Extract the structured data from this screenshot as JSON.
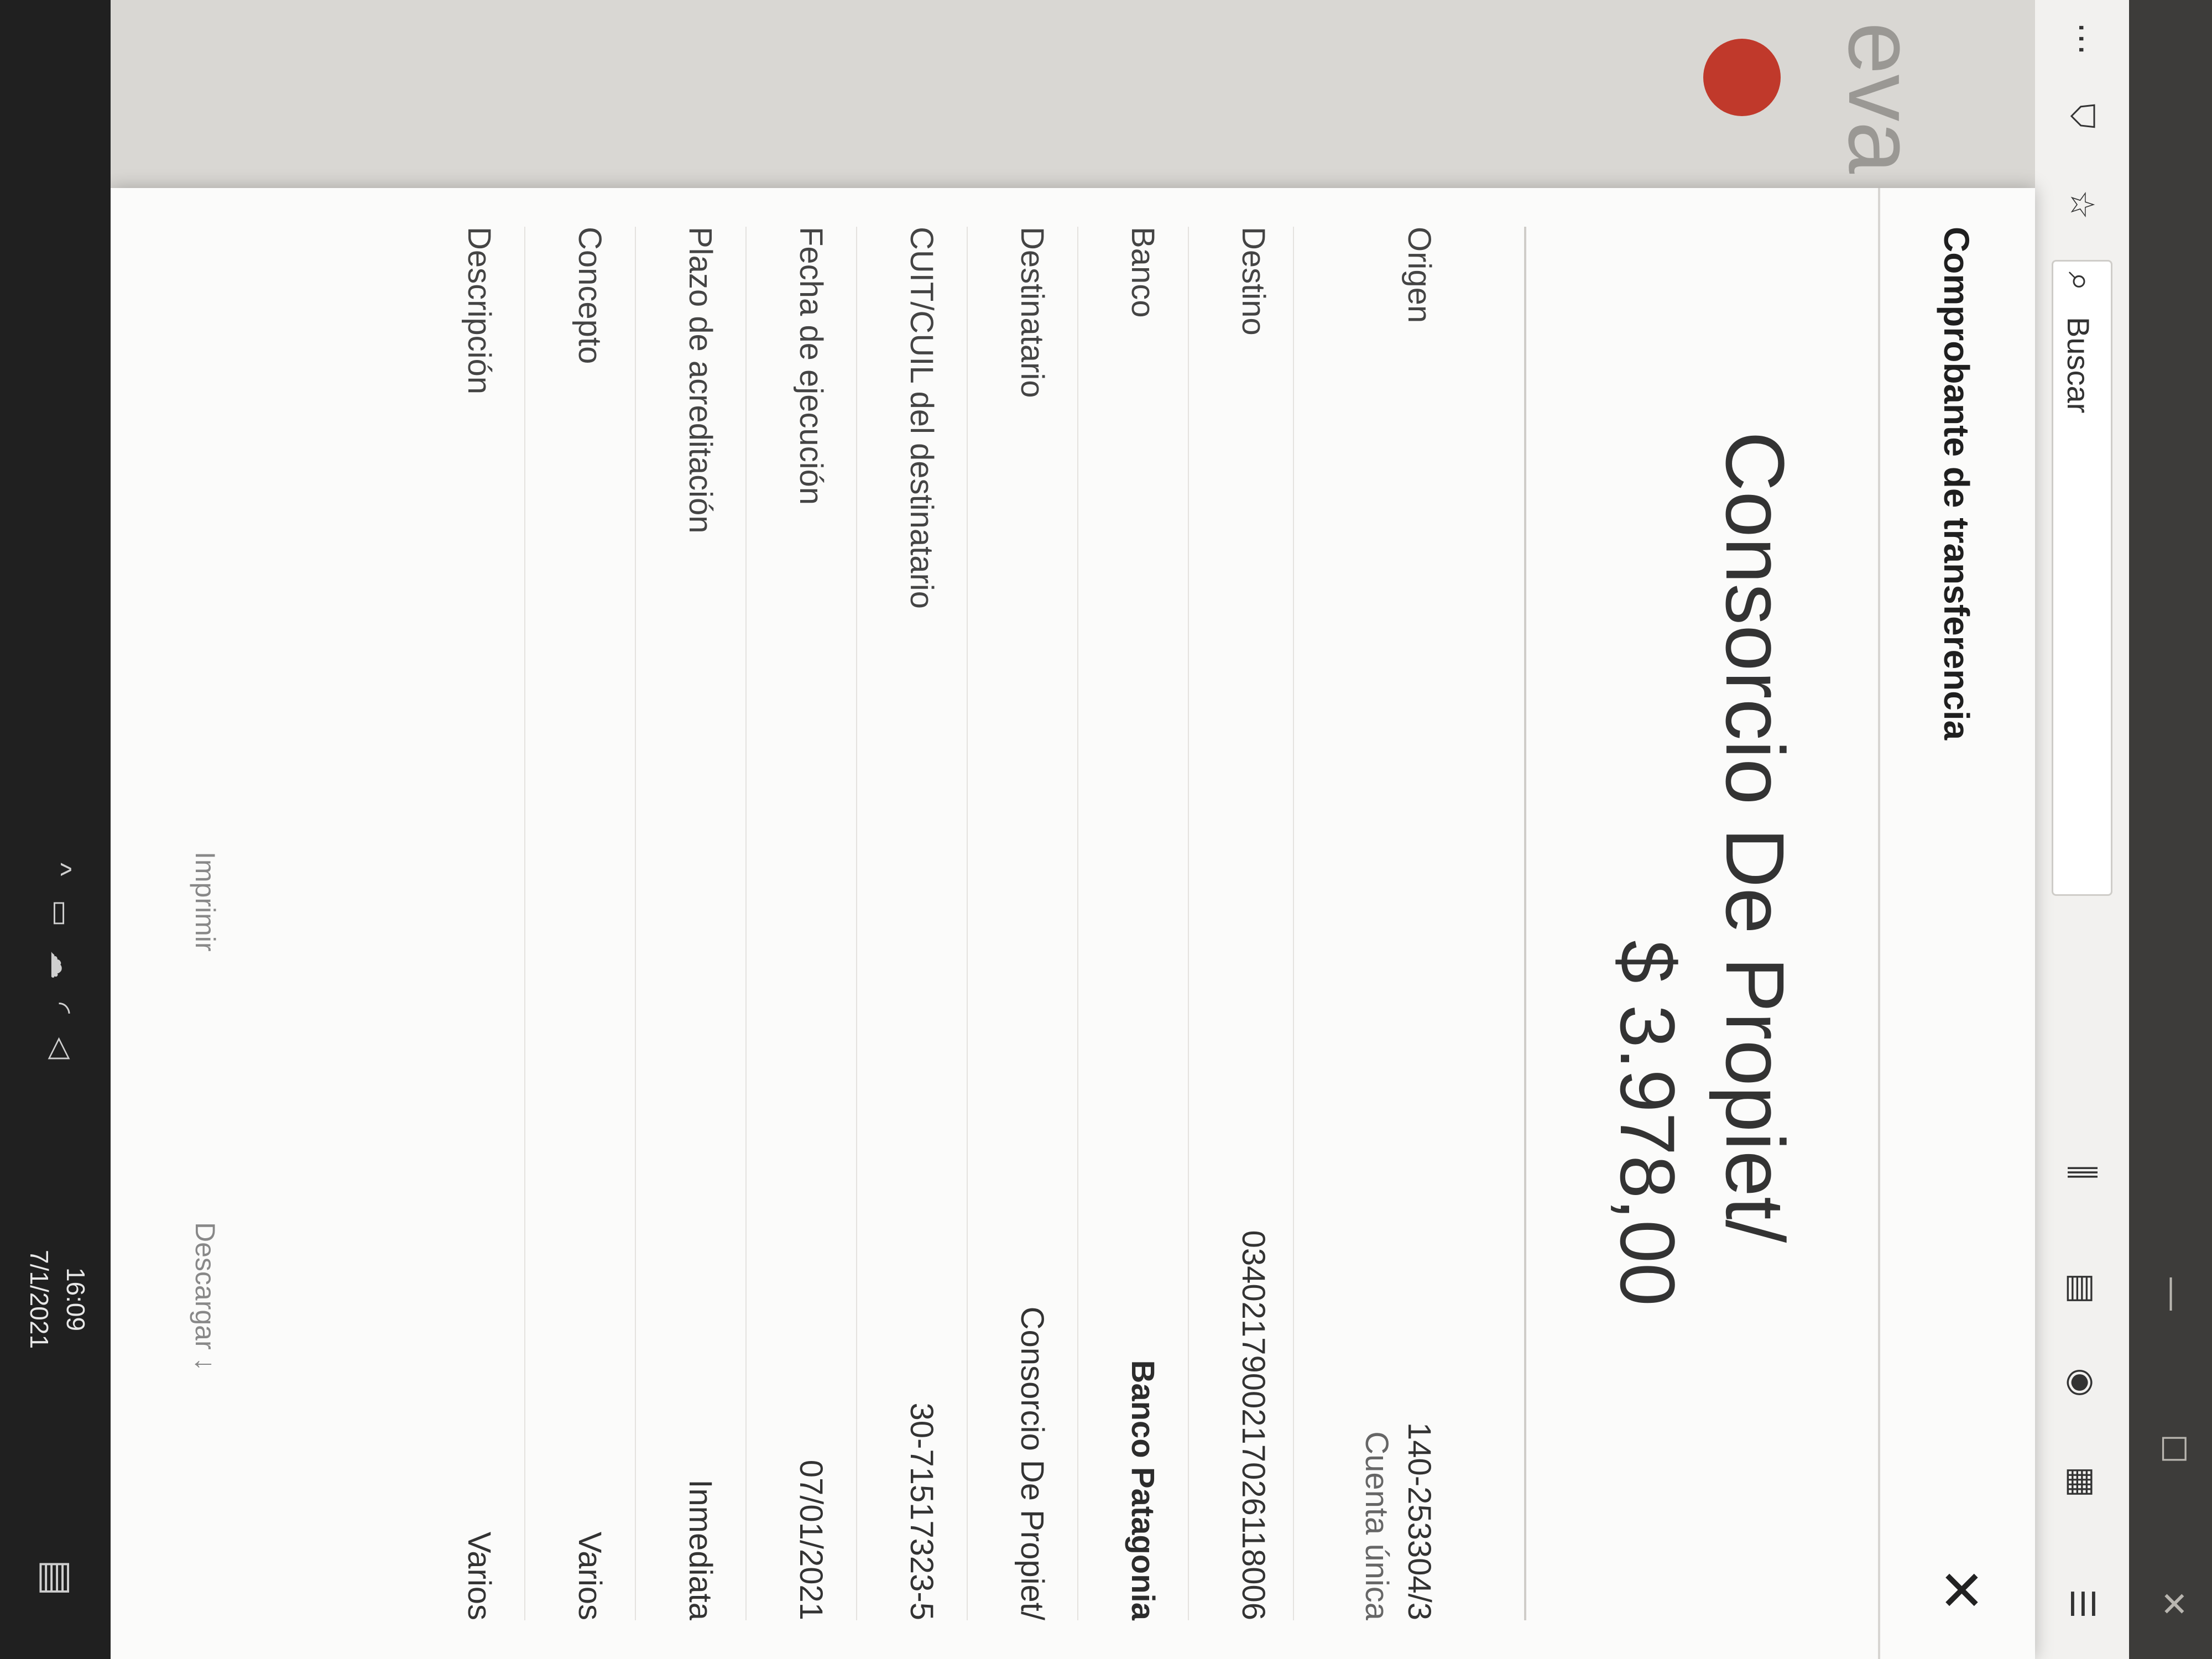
{
  "toolbar": {
    "search_placeholder": "Buscar"
  },
  "page": {
    "heading_fragment": "eva tra"
  },
  "modal": {
    "title": "Comprobante de transferencia",
    "close_symbol": "✕",
    "payee_name": "Consorcio De Propiet/",
    "amount": "$ 3.978,00",
    "rows": [
      {
        "label": "Origen",
        "value": "140-253304/3",
        "subvalue": "Cuenta única"
      },
      {
        "label": "Destino",
        "value": "0340217900217026118006"
      },
      {
        "label": "Banco",
        "value": "Banco Patagonia"
      },
      {
        "label": "Destinatario",
        "value": "Consorcio De Propiet/"
      },
      {
        "label": "CUIT/CUIL del destinatario",
        "value": "30-71517323-5"
      },
      {
        "label": "Fecha de ejecución",
        "value": "07/01/2021"
      },
      {
        "label": "Plazo de acreditación",
        "value": "Inmediata"
      },
      {
        "label": "Concepto",
        "value": "Varios"
      },
      {
        "label": "Descripción",
        "value": "Varios"
      }
    ],
    "print_label": "Imprimir",
    "download_label": "Descargar ↓"
  },
  "taskbar": {
    "time": "16:09",
    "date": "7/1/2021"
  },
  "icons": {
    "titlebar": [
      "close-icon",
      "maximize-icon",
      "minimize-icon"
    ],
    "toolbar": [
      "menu-dots-icon",
      "pocket-icon",
      "star-icon",
      "search-icon",
      "library-icon",
      "sidebar-icon",
      "account-icon",
      "extensions-icon",
      "hamburger-menu-icon"
    ],
    "tray": [
      "chevron-up-icon",
      "battery-icon",
      "cloud-icon",
      "wifi-icon",
      "volume-icon",
      "notification-icon"
    ]
  },
  "colors": {
    "modal_background": "#fbfbfa",
    "page_background": "#d9d7d3",
    "taskbar": "#202020",
    "badge_red": "#c0392b"
  }
}
